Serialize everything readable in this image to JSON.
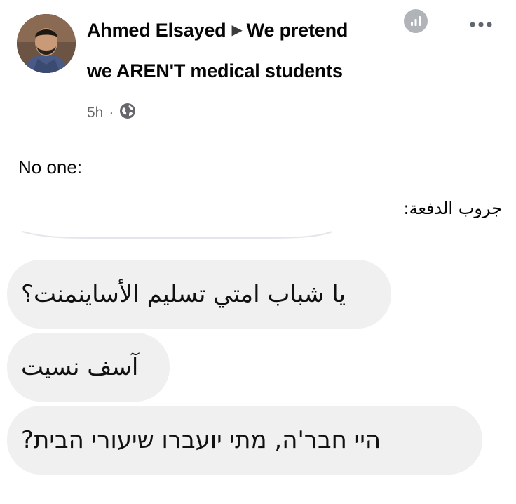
{
  "post": {
    "author": "Ahmed Elsayed",
    "group_line1": "We pretend",
    "group_line2": "we AREN'T medical students",
    "time": "5h",
    "separator": "·",
    "icons": {
      "arrow": "triangle-right-icon",
      "privacy": "globe-icon",
      "insights": "bar-chart-icon",
      "more": "more-horizontal-icon"
    }
  },
  "content": {
    "line1": "No one:",
    "line2": "جروب الدفعة:"
  },
  "chat": {
    "messages": [
      {
        "text": "يا شباب امتي تسليم الأساينمنت؟"
      },
      {
        "text": "آسف نسيت"
      },
      {
        "text": "היי חבר'ה, מתי יועברו שיעורי הבית?"
      }
    ]
  },
  "colors": {
    "text": "#050505",
    "meta": "#65676b",
    "bubble": "#f0f0f0",
    "icon_gray": "#b0b3b8"
  }
}
